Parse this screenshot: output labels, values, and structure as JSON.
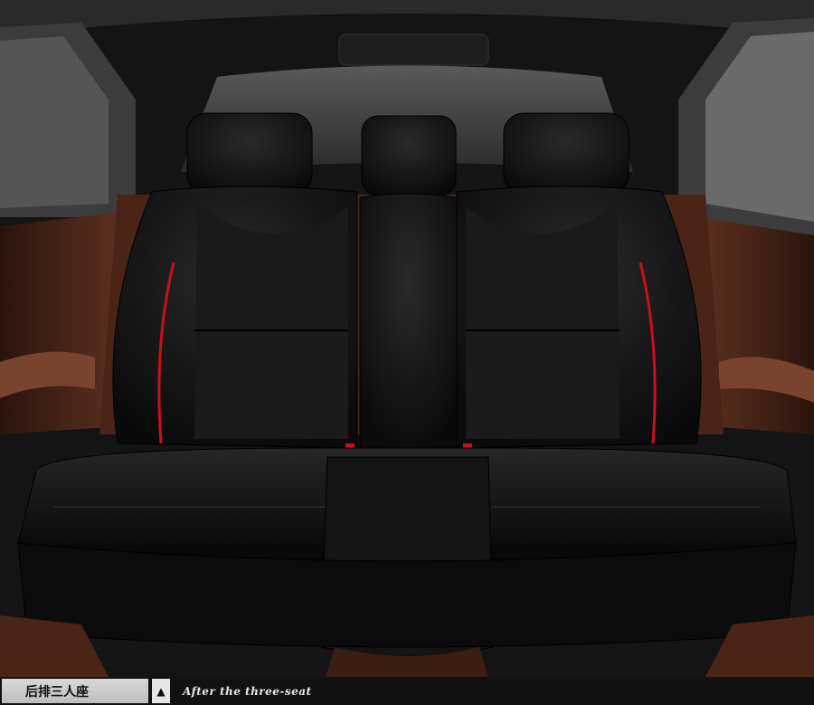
{
  "caption": {
    "chinese_label": "后排三人座",
    "english_label": "After the three-seat",
    "arrow_glyph": "▲"
  },
  "colors": {
    "leather_black": "#121212",
    "accent_red": "#c8101a",
    "trim_brown": "#5a2e1c"
  }
}
